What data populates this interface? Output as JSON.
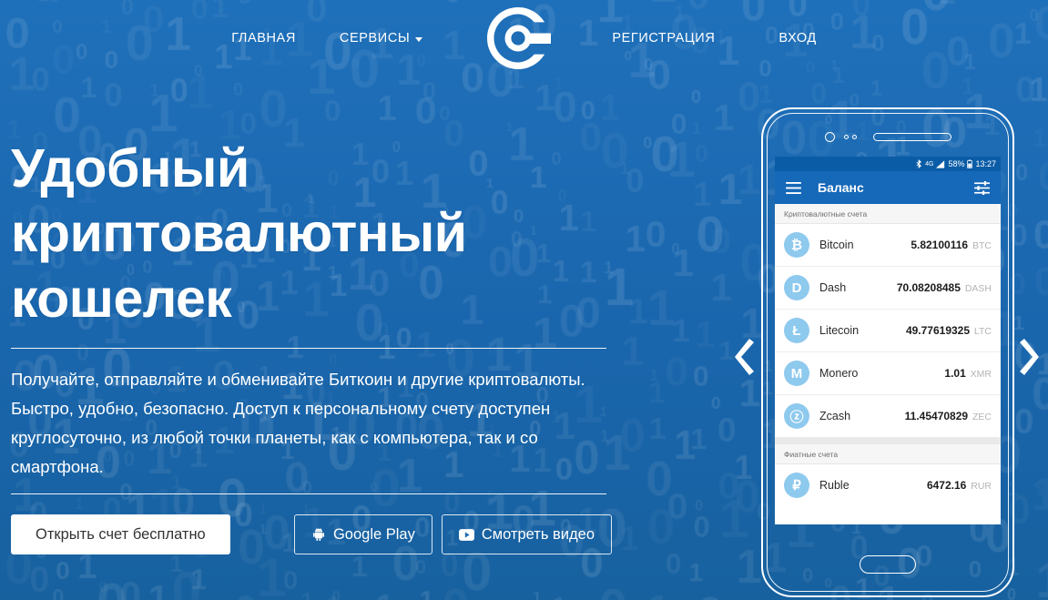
{
  "brand": {
    "logo_icon": "cryptocurrency-c-logo",
    "accent_blue": "#1e6db5",
    "appbar_blue": "#1668b8",
    "statusbar_blue": "#0b5ca6",
    "coin_badge_blue": "#8ec9ee"
  },
  "nav": {
    "left_items": [
      {
        "label": "ГЛАВНАЯ",
        "name": "nav-home",
        "has_caret": false
      },
      {
        "label": "СЕРВИСЫ",
        "name": "nav-services",
        "has_caret": true
      }
    ],
    "right_items": [
      {
        "label": "РЕГИСТРАЦИЯ",
        "name": "nav-register"
      },
      {
        "label": "ВХОД",
        "name": "nav-login"
      }
    ]
  },
  "hero": {
    "heading": "Удобный криптовалютный кошелек",
    "paragraph": "Получайте, отправляйте и обменивайте Биткоин и другие криптовалюты. Быстро, удобно, безопасно. Доступ к персональному счету доступен круглосуточно, из любой точки планеты, как с компьютера, так и со смартфона.",
    "buttons": {
      "primary": "Открыть счет бесплатно",
      "google_play": "Google Play",
      "watch_video": "Смотреть видео"
    },
    "icons": {
      "google_play": "android-icon",
      "watch_video": "youtube-play-icon"
    }
  },
  "carousel": {
    "prev_icon": "chevron-left-icon",
    "next_icon": "chevron-right-icon"
  },
  "phone": {
    "status_bar": {
      "bluetooth_icon": "bluetooth-icon",
      "network": "4G",
      "signal_icon": "signal-bars-icon",
      "battery_percent": "58%",
      "battery_icon": "battery-icon",
      "time": "13:27"
    },
    "app_bar": {
      "menu_icon": "hamburger-menu-icon",
      "title": "Баланс",
      "tune_icon": "tune-sliders-icon"
    },
    "sections": [
      {
        "title": "Криптовалютные счета",
        "rows": [
          {
            "name": "Bitcoin",
            "amount": "5.82100116",
            "ticker": "BTC",
            "symbol": "₿"
          },
          {
            "name": "Dash",
            "amount": "70.08208485",
            "ticker": "DASH",
            "symbol": "D"
          },
          {
            "name": "Litecoin",
            "amount": "49.77619325",
            "ticker": "LTC",
            "symbol": "Ł"
          },
          {
            "name": "Monero",
            "amount": "1.01",
            "ticker": "XMR",
            "symbol": "M"
          },
          {
            "name": "Zcash",
            "amount": "11.45470829",
            "ticker": "ZEC",
            "symbol": "ⓩ"
          }
        ]
      },
      {
        "title": "Фиатные счета",
        "rows": [
          {
            "name": "Ruble",
            "amount": "6472.16",
            "ticker": "RUR",
            "symbol": "₽"
          }
        ]
      }
    ]
  }
}
